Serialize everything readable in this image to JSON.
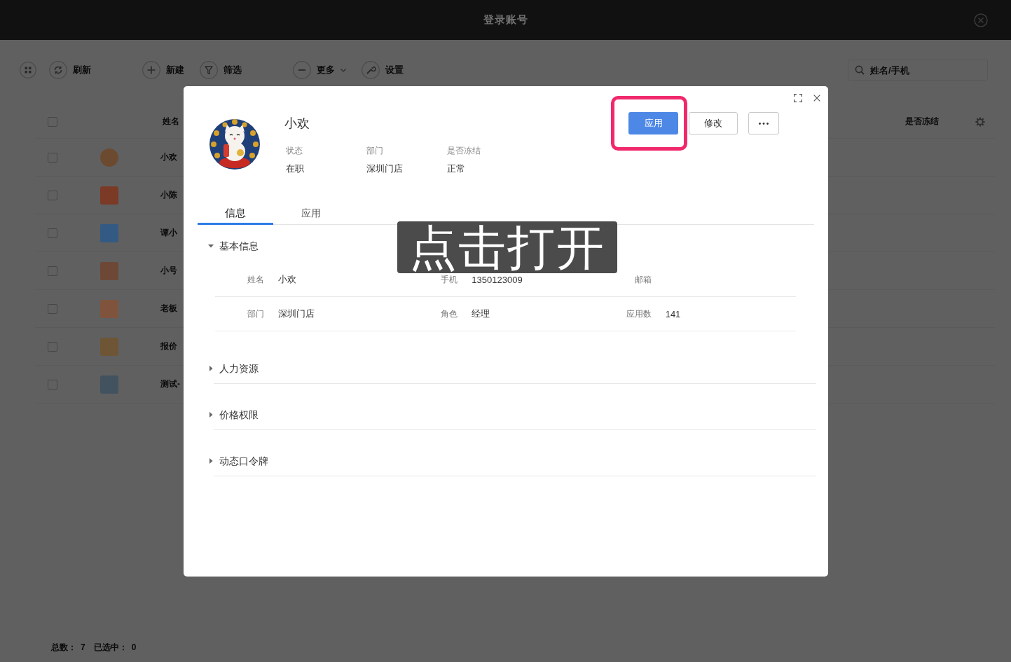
{
  "top_bar": {
    "title": "登录账号"
  },
  "toolbar": {
    "groups": [
      {
        "items": [
          {
            "label": "刷新",
            "menu": false
          }
        ]
      },
      {
        "items": [
          {
            "label": "新建",
            "menu": false
          },
          {
            "label": "筛选",
            "menu": false
          }
        ]
      },
      {
        "items": [
          {
            "label": "更多",
            "menu": true
          },
          {
            "label": "设置",
            "menu": false
          }
        ]
      }
    ],
    "search": {
      "placeholder": "姓名/手机"
    }
  },
  "table": {
    "select_all": {
      "checked": false
    },
    "columns": [
      {
        "label": "姓名"
      },
      {
        "label": "是否冻结"
      }
    ],
    "rows": [
      {
        "name": "小欢",
        "checked": false
      },
      {
        "name": "小陈",
        "checked": false
      },
      {
        "name": "谭小",
        "checked": false
      },
      {
        "name": "小号",
        "checked": false
      },
      {
        "name": "老板",
        "checked": false
      },
      {
        "name": "报价",
        "checked": false
      },
      {
        "name": "测试-",
        "checked": false
      }
    ]
  },
  "status_bar": {
    "total_label": "总数：",
    "total": "7",
    "selected_label": "已选中：",
    "selected": "0"
  },
  "dialog": {
    "profile": {
      "name": "小欢",
      "fields": [
        {
          "label": "状态",
          "value": "在职"
        },
        {
          "label": "部门",
          "value": "深圳门店"
        },
        {
          "label": "是否冻结",
          "value": "正常"
        }
      ]
    },
    "actions": [
      {
        "label": "应用",
        "kind": "primary",
        "highlighted": true
      },
      {
        "label": "修改",
        "kind": "default",
        "highlighted": false
      },
      {
        "kind": "more",
        "highlighted": false
      }
    ],
    "tabs": [
      {
        "label": "信息",
        "selected": true
      },
      {
        "label": "应用",
        "selected": false
      }
    ],
    "sections": [
      {
        "title": "基本信息",
        "expanded": true,
        "fields": [
          {
            "label": "姓名",
            "value": "小欢"
          },
          {
            "label": "手机",
            "value": "1350123009"
          },
          {
            "label": "邮箱"
          },
          {
            "label": "部门",
            "value": "深圳门店"
          },
          {
            "label": "角色",
            "value": "经理"
          },
          {
            "label": "应用数",
            "value": "141"
          }
        ]
      },
      {
        "title": "人力资源",
        "expanded": false
      },
      {
        "title": "价格权限",
        "expanded": false
      },
      {
        "title": "动态口令牌",
        "expanded": false
      }
    ]
  },
  "caption": {
    "text": "点击打开"
  }
}
